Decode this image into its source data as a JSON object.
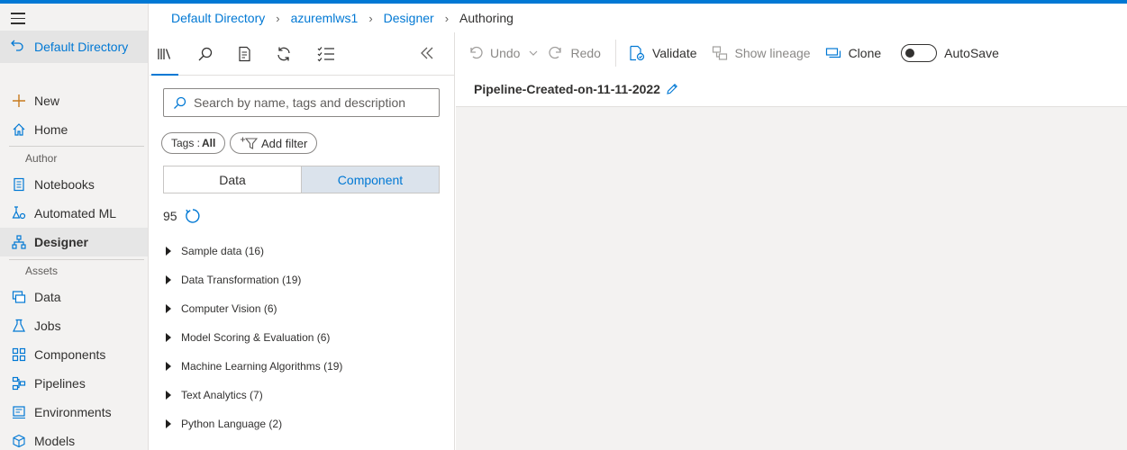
{
  "leftnav": {
    "directory": "Default Directory",
    "items_top": [
      {
        "label": "New",
        "icon": "plus-icon"
      },
      {
        "label": "Home",
        "icon": "home-icon"
      }
    ],
    "section_author": "Author",
    "items_author": [
      {
        "label": "Notebooks",
        "icon": "notebook-icon"
      },
      {
        "label": "Automated ML",
        "icon": "automl-icon"
      },
      {
        "label": "Designer",
        "icon": "designer-icon",
        "active": true
      }
    ],
    "section_assets": "Assets",
    "items_assets": [
      {
        "label": "Data",
        "icon": "data-icon"
      },
      {
        "label": "Jobs",
        "icon": "flask-icon"
      },
      {
        "label": "Components",
        "icon": "components-icon"
      },
      {
        "label": "Pipelines",
        "icon": "pipelines-icon"
      },
      {
        "label": "Environments",
        "icon": "environment-icon"
      },
      {
        "label": "Models",
        "icon": "models-icon"
      }
    ]
  },
  "breadcrumb": [
    "Default Directory",
    "azuremlws1",
    "Designer",
    "Authoring"
  ],
  "library": {
    "search_placeholder": "Search by name, tags and description",
    "tags_label": "Tags :",
    "tags_value": "All",
    "add_filter": "Add filter",
    "tabs": {
      "data": "Data",
      "component": "Component"
    },
    "selected_tab": "Component",
    "count": "95",
    "categories": [
      "Sample data (16)",
      "Data Transformation (19)",
      "Computer Vision (6)",
      "Model Scoring & Evaluation (6)",
      "Machine Learning Algorithms (19)",
      "Text Analytics (7)",
      "Python Language (2)"
    ]
  },
  "toolbar": {
    "undo": "Undo",
    "redo": "Redo",
    "validate": "Validate",
    "show_lineage": "Show lineage",
    "clone": "Clone",
    "autosave": "AutoSave",
    "autosave_on": false
  },
  "pipeline": {
    "title": "Pipeline-Created-on-11-11-2022"
  },
  "colors": {
    "accent": "#0078d4",
    "nav_bg": "#f3f2f1",
    "canvas_bg": "#f3f2f1"
  }
}
